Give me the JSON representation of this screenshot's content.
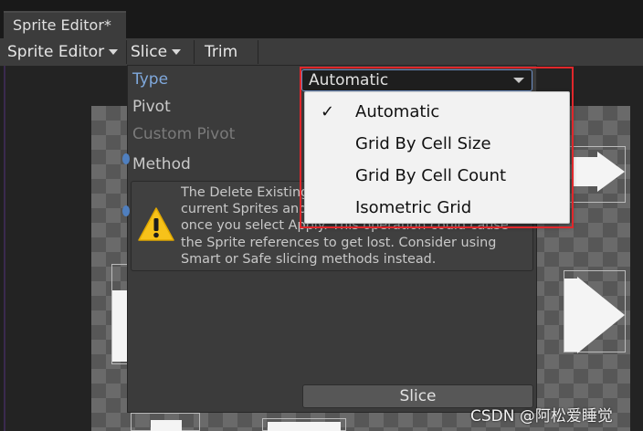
{
  "window": {
    "tab_title": "Sprite Editor*"
  },
  "toolbar": {
    "sprite_editor_label": "Sprite Editor",
    "slice_label": "Slice",
    "trim_label": "Trim"
  },
  "slice_panel": {
    "type_label": "Type",
    "pivot_label": "Pivot",
    "custom_pivot_label": "Custom Pivot",
    "method_label": "Method",
    "type_value": "Automatic",
    "help_lines": [
      "The Delete Existing",
      "current Sprites and",
      "once you select Apply. This operation could cause",
      "the Sprite references to get lost. Consider using",
      "Smart or Safe slicing methods instead."
    ],
    "slice_button_label": "Slice"
  },
  "type_dropdown": {
    "checkmark": "✓",
    "options": [
      "Automatic",
      "Grid By Cell Size",
      "Grid By Cell Count",
      "Isometric Grid"
    ],
    "selected_index": 0
  },
  "watermark": "CSDN @阿松爱睡觉",
  "colors": {
    "highlight_border": "#e0272b",
    "panel_bg": "#3b3b3b",
    "menu_bg": "#f2f2f2",
    "focus_border": "#6d8fc4",
    "warning_yellow": "#f7c21a"
  },
  "icons": {
    "warning": "warning-triangle-icon",
    "checkmark": "checkmark-icon",
    "dropdown_caret": "chevron-down-icon"
  }
}
